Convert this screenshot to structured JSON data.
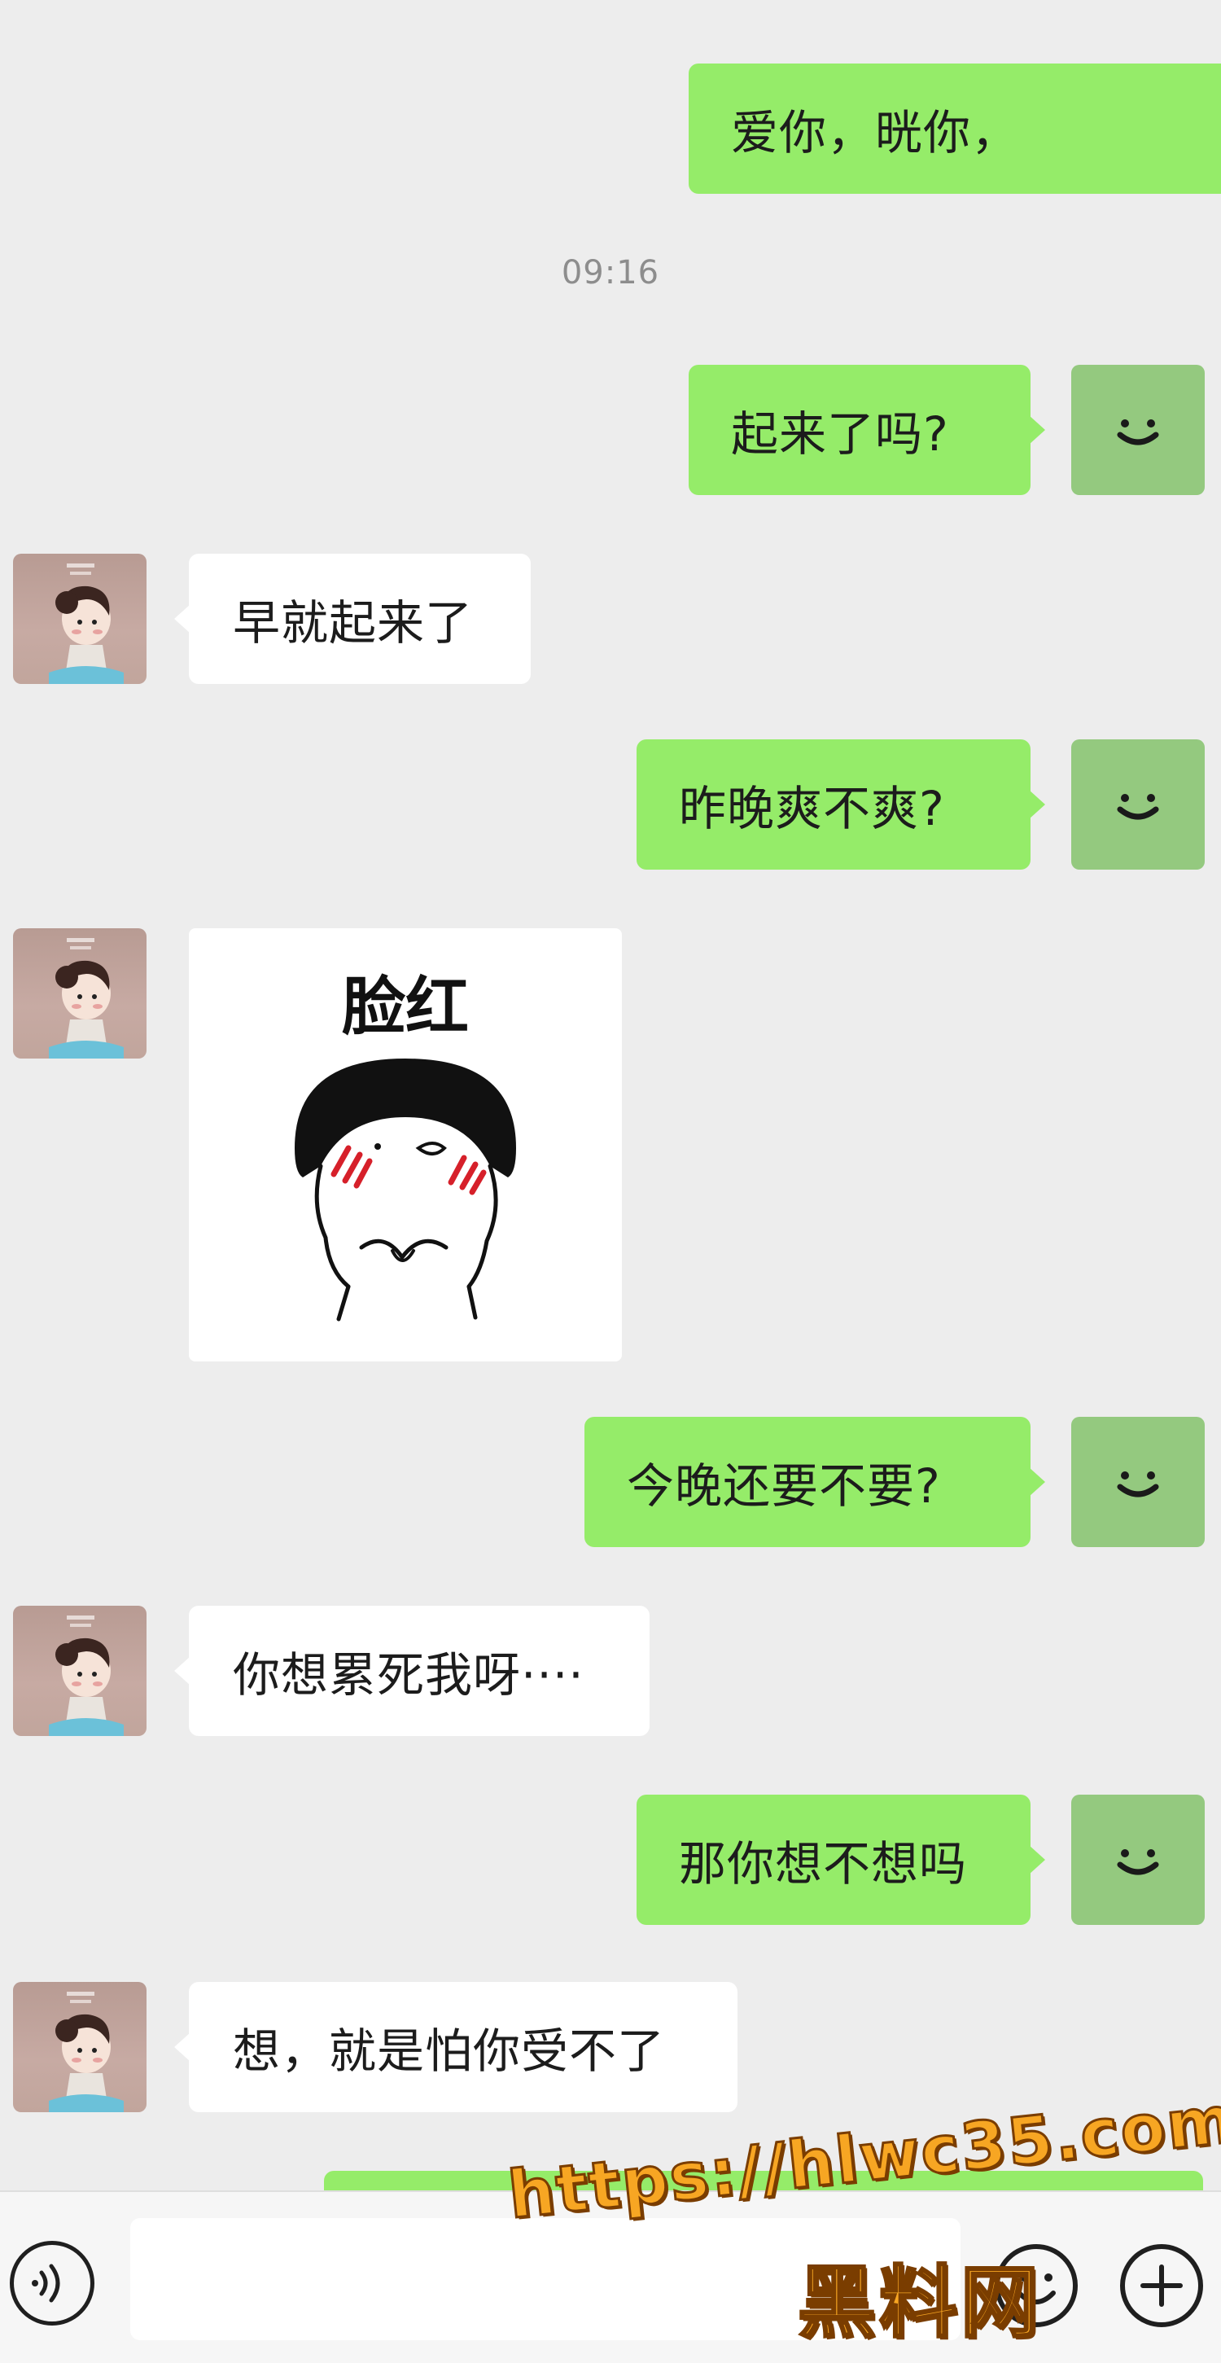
{
  "chat": {
    "timestamp": "09:16",
    "messages": [
      {
        "from": "self",
        "text": "爱你，晄你，"
      },
      {
        "from": "self",
        "text": "起来了吗?"
      },
      {
        "from": "peer",
        "text": "早就起来了"
      },
      {
        "from": "self",
        "text": "昨晚爽不爽?"
      },
      {
        "from": "peer",
        "type": "sticker",
        "caption": "脸红"
      },
      {
        "from": "self",
        "text": "今晚还要不要?"
      },
      {
        "from": "peer",
        "text": "你想累死我呀····"
      },
      {
        "from": "self",
        "text": "那你想不想吗"
      },
      {
        "from": "peer",
        "text": "想，就是怕你受不了"
      }
    ]
  },
  "input_bar": {
    "text_value": "",
    "voice_icon": "voice-icon",
    "emoji_icon": "emoji-icon",
    "plus_icon": "plus-icon"
  },
  "watermark": {
    "url": "https://hlwc35.com",
    "name": "黑料网"
  },
  "colors": {
    "background": "#ededed",
    "outgoing_bubble": "#95ec69",
    "incoming_bubble": "#ffffff",
    "self_avatar": "#94c97f",
    "watermark": "#f7a623"
  }
}
